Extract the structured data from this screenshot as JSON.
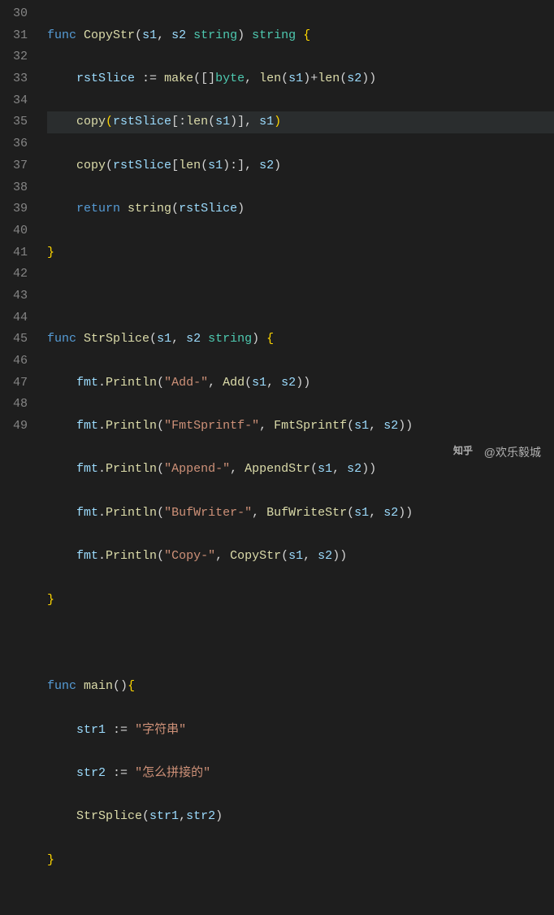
{
  "line_numbers": [
    "30",
    "31",
    "32",
    "33",
    "34",
    "35",
    "36",
    "37",
    "38",
    "39",
    "40",
    "41",
    "42",
    "43",
    "44",
    "45",
    "46",
    "47",
    "48",
    "49"
  ],
  "code": {
    "l30": {
      "func": "func",
      "name": "CopyStr",
      "p1": "s1",
      "p2": "s2",
      "type": "string",
      "ret": "string",
      "ob": "{"
    },
    "l31": {
      "v": "rstSlice",
      "op": ":=",
      "fn": "make",
      "bt": "byte",
      "lf": "len",
      "a1": "s1",
      "a2": "s2"
    },
    "l32": {
      "fn": "copy",
      "v": "rstSlice",
      "lf": "len",
      "a1": "s1",
      "a2": "s1"
    },
    "l33": {
      "fn": "copy",
      "v": "rstSlice",
      "lf": "len",
      "a1": "s1",
      "a2": "s2"
    },
    "l34": {
      "ret": "return",
      "fn": "string",
      "v": "rstSlice"
    },
    "l35": {
      "cb": "}"
    },
    "l37": {
      "func": "func",
      "name": "StrSplice",
      "p1": "s1",
      "p2": "s2",
      "type": "string",
      "ob": "{"
    },
    "l38": {
      "pkg": "fmt",
      "fn": "Println",
      "s": "\"Add-\"",
      "call": "Add",
      "a1": "s1",
      "a2": "s2"
    },
    "l39": {
      "pkg": "fmt",
      "fn": "Println",
      "s": "\"FmtSprintf-\"",
      "call": "FmtSprintf",
      "a1": "s1",
      "a2": "s2"
    },
    "l40": {
      "pkg": "fmt",
      "fn": "Println",
      "s": "\"Append-\"",
      "call": "AppendStr",
      "a1": "s1",
      "a2": "s2"
    },
    "l41": {
      "pkg": "fmt",
      "fn": "Println",
      "s": "\"BufWriter-\"",
      "call": "BufWriteStr",
      "a1": "s1",
      "a2": "s2"
    },
    "l42": {
      "pkg": "fmt",
      "fn": "Println",
      "s": "\"Copy-\"",
      "call": "CopyStr",
      "a1": "s1",
      "a2": "s2"
    },
    "l43": {
      "cb": "}"
    },
    "l45": {
      "func": "func",
      "name": "main",
      "ob": "{"
    },
    "l46": {
      "v": "str1",
      "op": ":=",
      "s": "\"字符串\""
    },
    "l47": {
      "v": "str2",
      "op": ":=",
      "s": "\"怎么拼接的\""
    },
    "l48": {
      "fn": "StrSplice",
      "a1": "str1",
      "a2": "str2"
    },
    "l49": {
      "cb": "}"
    }
  },
  "watermark": {
    "text": "@欢乐毅城",
    "logo": "知乎"
  }
}
